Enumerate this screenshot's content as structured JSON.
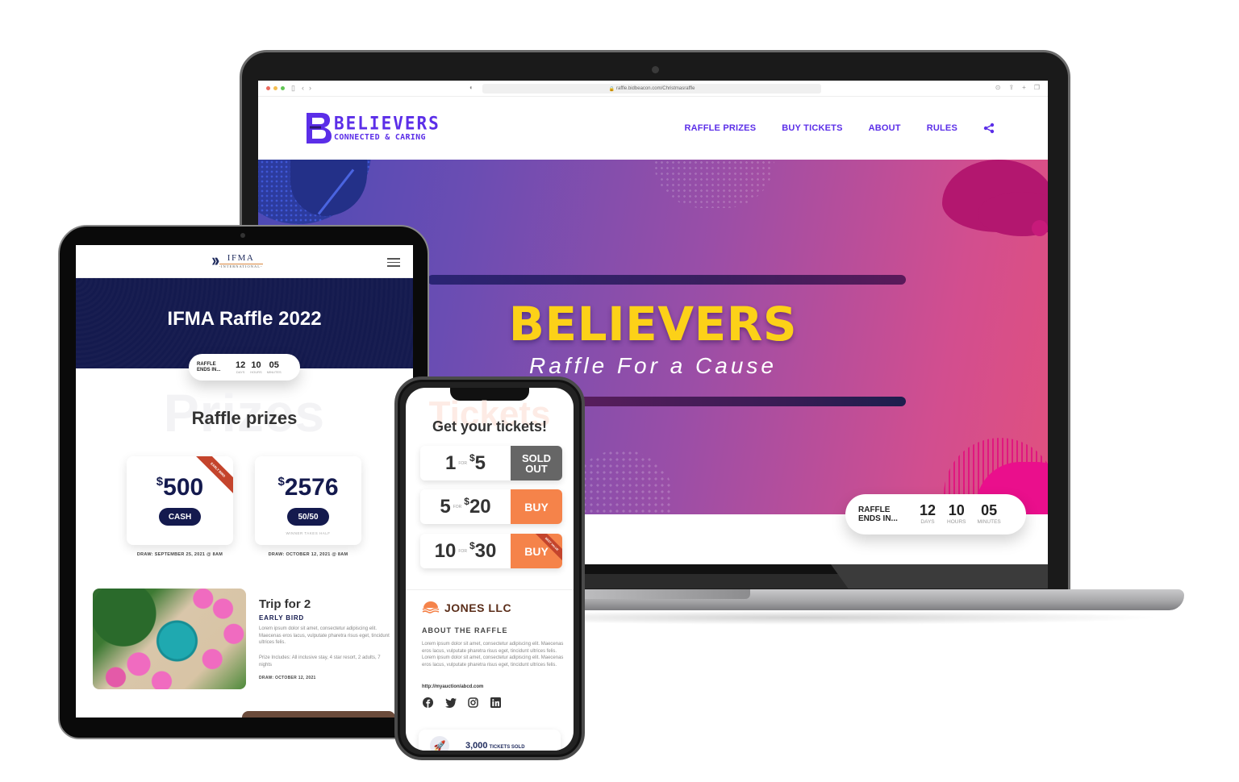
{
  "laptop": {
    "browser": {
      "url": "raffle.bidbeacon.com/Christmasraffle",
      "traffic_lights": [
        "#ec6a5e",
        "#f4be4f",
        "#61c554"
      ]
    },
    "site": {
      "logo_title": "BELIEVERS",
      "logo_subtitle": "CONNECTED & CARING",
      "brand_color": "#5b2ee8",
      "nav": [
        "RAFFLE PRIZES",
        "BUY TICKETS",
        "ABOUT",
        "RULES"
      ],
      "hero_title": "BELIEVERS",
      "hero_subtitle": "Raffle For a Cause",
      "hero_title_color": "#fcd118"
    },
    "countdown": {
      "label_line1": "RAFFLE",
      "label_line2": "ENDS IN...",
      "units": [
        {
          "value": "12",
          "caption": "DAYS"
        },
        {
          "value": "10",
          "caption": "HOURS"
        },
        {
          "value": "05",
          "caption": "MINUTES"
        }
      ]
    }
  },
  "tablet": {
    "logo_name": "IFMA",
    "logo_sub": "-INTERNATIONAL-",
    "hero_title": "IFMA Raffle 2022",
    "countdown": {
      "label_line1": "RAFFLE",
      "label_line2": "ENDS IN...",
      "units": [
        {
          "value": "12",
          "caption": "DAYS"
        },
        {
          "value": "10",
          "caption": "HOURS"
        },
        {
          "value": "05",
          "caption": "MINUTES"
        }
      ]
    },
    "prizes_watermark": "Prizes",
    "prizes_title": "Raffle prizes",
    "prizes": [
      {
        "currency": "$",
        "amount": "500",
        "type": "CASH",
        "ribbon": "EARLY BIRD",
        "note": "",
        "draw": "DRAW: SEPTEMBER 25, 2021 @ 8AM"
      },
      {
        "currency": "$",
        "amount": "2576",
        "type": "50/50",
        "ribbon": "",
        "note": "WINNER TAKES HALF",
        "draw": "DRAW: OCTOBER 12, 2021 @ 8AM"
      }
    ],
    "featured": {
      "title": "Trip for 2",
      "subtitle": "EARLY BIRD",
      "description": "Lorem ipsum dolor sit amet, consectetur adipiscing elit. Maecenas eros lacus, vulputate pharetra risus eget, tincidunt ultrices felis.",
      "includes": "Prize Includes: All inclusive stay, 4 star resort, 2 adults, 7 nights",
      "draw": "DRAW: OCTOBER 12, 2021"
    }
  },
  "phone": {
    "tickets_watermark": "Tickets",
    "tickets_title": "Get your tickets!",
    "ticket_options": [
      {
        "qty": "1",
        "for": "FOR",
        "currency": "$",
        "price": "5",
        "action": "SOLD OUT",
        "status": "sold",
        "ribbon": ""
      },
      {
        "qty": "5",
        "for": "FOR",
        "currency": "$",
        "price": "20",
        "action": "BUY",
        "status": "buy",
        "ribbon": ""
      },
      {
        "qty": "10",
        "for": "FOR",
        "currency": "$",
        "price": "30",
        "action": "BUY",
        "status": "buy",
        "ribbon": "BEST VALUE"
      }
    ],
    "org_name": "JONES LLC",
    "about_title": "ABOUT THE RAFFLE",
    "about_body": "Lorem ipsum dolor sit amet, consectetur adipiscing elit. Maecenas eros lacus, vulputate pharetra risus eget, tincidunt ultrices felis. Lorem ipsum dolor sit amet, consectetur adipiscing elit. Maecenas eros lacus, vulputate pharetra risus eget, tincidunt ultrices felis.",
    "link": "http://myauction/abcd.com",
    "socials": [
      "facebook-icon",
      "twitter-icon",
      "instagram-icon",
      "linkedin-icon"
    ],
    "tickets_sold": "3,000",
    "tickets_sold_label": "TICKETS SOLD",
    "accent_color": "#f5834a"
  }
}
